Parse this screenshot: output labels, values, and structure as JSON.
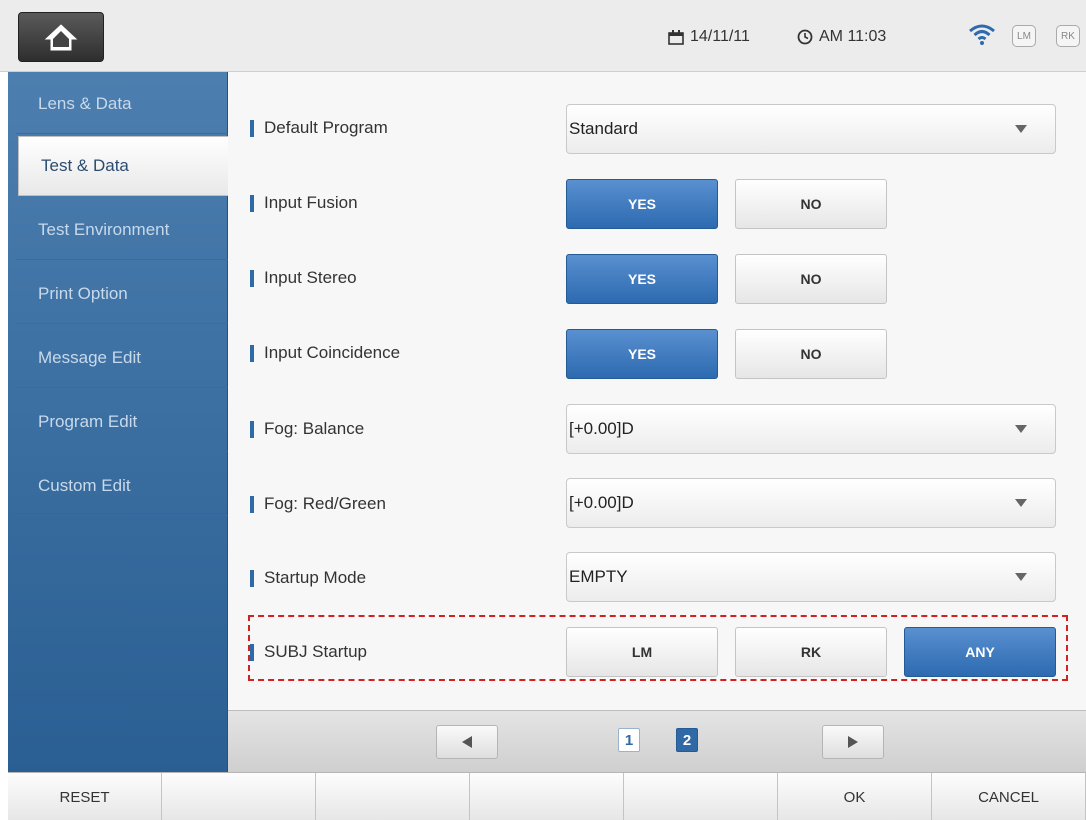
{
  "header": {
    "date": "14/11/11",
    "time": "AM 11:03",
    "badges": [
      "LM",
      "RK"
    ],
    "icons": [
      "home-icon",
      "calendar-icon",
      "clock-icon",
      "wifi-icon"
    ]
  },
  "sidebar": {
    "items": [
      {
        "label": "Lens & Data"
      },
      {
        "label": "Test & Data",
        "active": true
      },
      {
        "label": "Test Environment"
      },
      {
        "label": "Print Option"
      },
      {
        "label": "Message Edit"
      },
      {
        "label": "Program Edit"
      },
      {
        "label": "Custom Edit"
      }
    ]
  },
  "settings": {
    "default_program": {
      "label": "Default Program",
      "value": "Standard"
    },
    "input_fusion": {
      "label": "Input Fusion",
      "options": [
        "YES",
        "NO"
      ],
      "selected": "YES"
    },
    "input_stereo": {
      "label": "Input Stereo",
      "options": [
        "YES",
        "NO"
      ],
      "selected": "YES"
    },
    "input_coincidence": {
      "label": "Input Coincidence",
      "options": [
        "YES",
        "NO"
      ],
      "selected": "YES"
    },
    "fog_balance": {
      "label": "Fog: Balance",
      "value": "[+0.00]D"
    },
    "fog_red_green": {
      "label": "Fog: Red/Green",
      "value": "[+0.00]D"
    },
    "startup_mode": {
      "label": "Startup Mode",
      "value": "EMPTY"
    },
    "subj_startup": {
      "label": "SUBJ Startup",
      "options": [
        "LM",
        "RK",
        "ANY"
      ],
      "selected": "ANY"
    }
  },
  "pagination": {
    "pages": [
      "1",
      "2"
    ],
    "current": "2"
  },
  "footer": {
    "buttons": [
      "RESET",
      "",
      "",
      "",
      "",
      "OK",
      "CANCEL"
    ]
  },
  "colors": {
    "accent": "#2e6aa5",
    "sidebar": "#3a6e9f",
    "highlight_border": "#d32020"
  }
}
